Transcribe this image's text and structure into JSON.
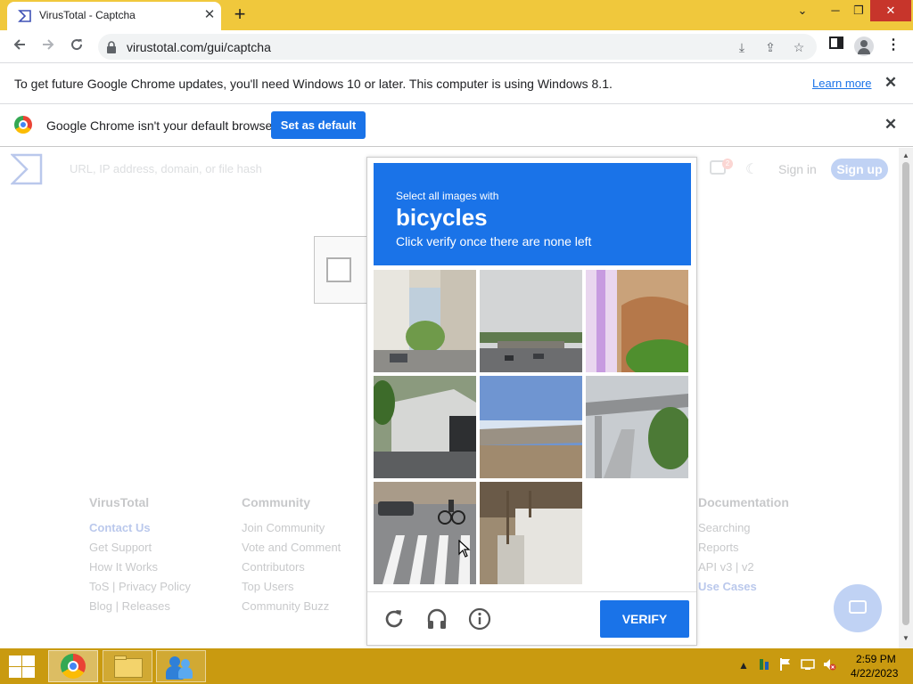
{
  "browser": {
    "tab_title": "VirusTotal - Captcha",
    "tab_close": "✕",
    "new_tab": "+",
    "url": "virustotal.com/gui/captcha",
    "window_controls": [
      "⌄",
      "─",
      "❐",
      "✕"
    ]
  },
  "infobar_update": {
    "text": "To get future Google Chrome updates, you'll need Windows 10 or later. This computer is using Windows 8.1.",
    "link": "Learn more",
    "close": "✕"
  },
  "infobar_default": {
    "text": "Google Chrome isn't your default browser",
    "button": "Set as default",
    "close": "✕"
  },
  "virustotal": {
    "search_placeholder": "URL, IP address, domain, or file hash",
    "notification_count": "2",
    "sign_in": "Sign in",
    "sign_up": "Sign up",
    "footer": [
      {
        "heading": "VirusTotal",
        "links": [
          "Contact Us",
          "Get Support",
          "How It Works",
          "ToS | Privacy Policy",
          "Blog | Releases"
        ]
      },
      {
        "heading": "Community",
        "links": [
          "Join Community",
          "Vote and Comment",
          "Contributors",
          "Top Users",
          "Community Buzz"
        ]
      },
      {
        "heading": "Documentation",
        "links": [
          "Searching",
          "Reports",
          "API v3 | v2",
          "Use Cases"
        ]
      }
    ]
  },
  "captcha": {
    "select_text": "Select all images with",
    "object": "bicycles",
    "instruction": "Click verify once there are none left",
    "verify_label": "VERIFY",
    "tiles": [
      {
        "subject": "street-with-buildings",
        "filled": true
      },
      {
        "subject": "highway-overpass",
        "filled": true
      },
      {
        "subject": "temple-with-plants",
        "filled": true
      },
      {
        "subject": "concrete-tunnel",
        "filled": true
      },
      {
        "subject": "bridge-sky",
        "filled": true
      },
      {
        "subject": "elevated-road",
        "filled": true
      },
      {
        "subject": "crosswalk-with-cyclist",
        "filled": true
      },
      {
        "subject": "construction-site",
        "filled": true
      },
      {
        "subject": "empty",
        "filled": false
      }
    ],
    "header_color": "#1a73e8"
  },
  "taskbar": {
    "time": "2:59 PM",
    "date": "4/22/2023",
    "apps": [
      "chrome-icon",
      "file-explorer-icon",
      "messenger-icon"
    ]
  },
  "colors": {
    "accent": "#1a73e8",
    "tabstrip": "#f0c83c",
    "taskbar": "#c99a10"
  }
}
